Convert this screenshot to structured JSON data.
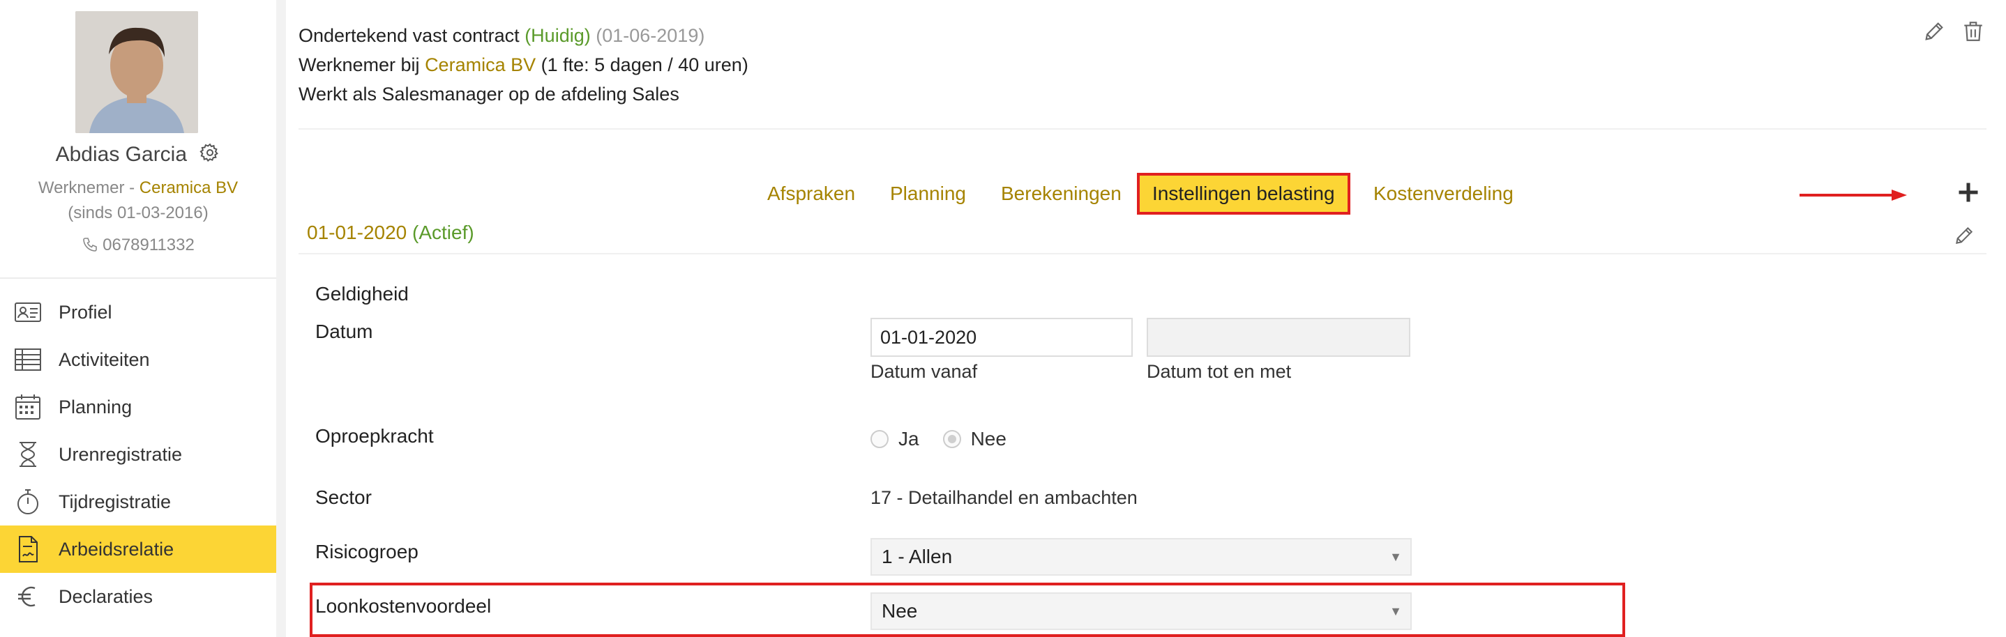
{
  "profile": {
    "name": "Abdias Garcia",
    "role_prefix": "Werknemer - ",
    "company": "Ceramica BV",
    "since": "(sinds 01-03-2016)",
    "phone": "0678911332"
  },
  "nav": {
    "items": [
      {
        "label": "Profiel",
        "icon": "id-card-icon"
      },
      {
        "label": "Activiteiten",
        "icon": "table-icon"
      },
      {
        "label": "Planning",
        "icon": "calendar-icon"
      },
      {
        "label": "Urenregistratie",
        "icon": "hourglass-icon"
      },
      {
        "label": "Tijdregistratie",
        "icon": "stopwatch-icon"
      },
      {
        "label": "Arbeidsrelatie",
        "icon": "contract-icon",
        "active": true
      },
      {
        "label": "Declaraties",
        "icon": "euro-icon"
      }
    ]
  },
  "contract": {
    "title": "Ondertekend vast contract",
    "status": "(Huidig)",
    "date": "(01-06-2019)",
    "employee_prefix": "Werknemer bij ",
    "employer": "Ceramica BV",
    "fte": " (1 fte: 5 dagen / 40 uren)",
    "function": "Werkt als Salesmanager op de afdeling Sales"
  },
  "tabs": [
    {
      "label": "Afspraken"
    },
    {
      "label": "Planning"
    },
    {
      "label": "Berekeningen"
    },
    {
      "label": "Instellingen belasting",
      "selected": true
    },
    {
      "label": "Kostenverdeling"
    }
  ],
  "period": {
    "date": "01-01-2020",
    "status": "(Actief)"
  },
  "form": {
    "section_title": "Geldigheid",
    "datum_label": "Datum",
    "datum_from_value": "01-01-2020",
    "datum_from_help": "Datum vanaf",
    "datum_to_value": "",
    "datum_to_help": "Datum tot en met",
    "oproep_label": "Oproepkracht",
    "oproep_options": [
      "Ja",
      "Nee"
    ],
    "oproep_selected": "Nee",
    "sector_label": "Sector",
    "sector_value": "17 - Detailhandel en ambachten",
    "risico_label": "Risicogroep",
    "risico_value": "1 - Allen",
    "loon_label": "Loonkostenvoordeel",
    "loon_value": "Nee"
  },
  "colors": {
    "accent_yellow": "#fcd535",
    "link_gold": "#a58300",
    "active_green": "#5a9a2a",
    "annotation_red": "#e02020"
  }
}
